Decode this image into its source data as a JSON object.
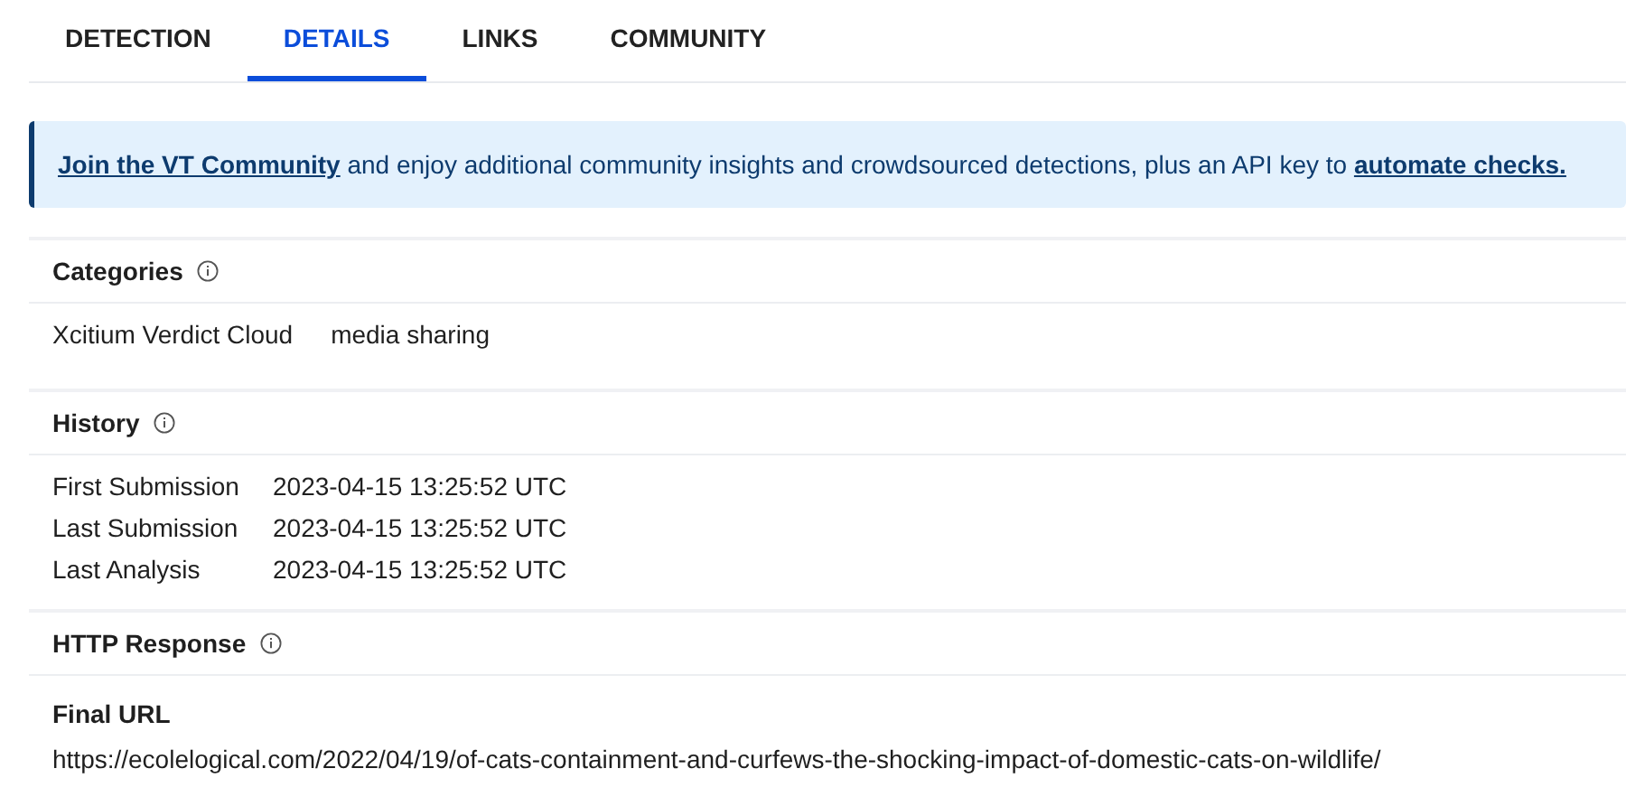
{
  "tabs": [
    {
      "label": "DETECTION",
      "selected": false
    },
    {
      "label": "DETAILS",
      "selected": true
    },
    {
      "label": "LINKS",
      "selected": false
    },
    {
      "label": "COMMUNITY",
      "selected": false
    }
  ],
  "banner": {
    "link": "Join the VT Community",
    "text": "and enjoy additional community insights and crowdsourced detections, plus an API key to",
    "end_link": "automate checks."
  },
  "categories": {
    "title": "Categories",
    "items": [
      "Xcitium Verdict Cloud",
      "media sharing"
    ]
  },
  "history": {
    "title": "History",
    "rows": [
      {
        "label": "First Submission",
        "value": "2023-04-15 13:25:52 UTC"
      },
      {
        "label": "Last Submission",
        "value": "2023-04-15 13:25:52 UTC"
      },
      {
        "label": "Last Analysis",
        "value": "2023-04-15 13:25:52 UTC"
      }
    ]
  },
  "http_response": {
    "title": "HTTP Response",
    "final_url_label": "Final URL",
    "final_url": "https://ecolelogical.com/2022/04/19/of-cats-containment-and-curfews-the-shocking-impact-of-domestic-cats-on-wildlife/"
  }
}
